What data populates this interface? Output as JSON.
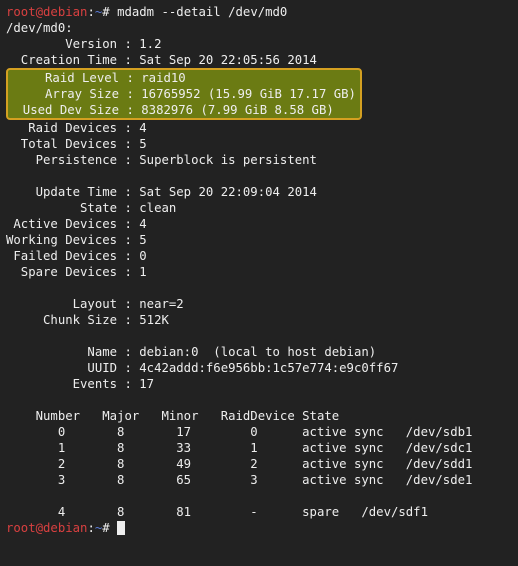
{
  "prompt1": {
    "user_host": "root@debian",
    "colon": ":",
    "path": "~",
    "hash": "# ",
    "cmd": "mdadm --detail /dev/md0"
  },
  "dev_line": "/dev/md0:",
  "kv": {
    "version": "        Version : 1.2",
    "creation": "  Creation Time : Sat Sep 20 22:05:56 2014",
    "raidlevel": "     Raid Level : raid10",
    "arraysize": "     Array Size : 16765952 (15.99 GiB 17.17 GB)",
    "useddev": "  Used Dev Size : 8382976 (7.99 GiB 8.58 GB)",
    "raiddevices": "   Raid Devices : 4",
    "totaldevices": "  Total Devices : 5",
    "persistence": "    Persistence : Superblock is persistent",
    "blank1": "",
    "updatetime": "    Update Time : Sat Sep 20 22:09:04 2014",
    "state": "          State : clean",
    "active": " Active Devices : 4",
    "working": "Working Devices : 5",
    "failed": " Failed Devices : 0",
    "spare": "  Spare Devices : 1",
    "blank2": "",
    "layout": "         Layout : near=2",
    "chunk": "     Chunk Size : 512K",
    "blank3": "",
    "name": "           Name : debian:0  (local to host debian)",
    "uuid": "           UUID : 4c42addd:f6e956bb:1c57e774:e9c0ff67",
    "events": "         Events : 17",
    "blank4": ""
  },
  "table": {
    "header": "    Number   Major   Minor   RaidDevice State",
    "rows": [
      "       0       8       17        0      active sync   /dev/sdb1",
      "       1       8       33        1      active sync   /dev/sdc1",
      "       2       8       49        2      active sync   /dev/sdd1",
      "       3       8       65        3      active sync   /dev/sde1",
      "",
      "       4       8       81        -      spare   /dev/sdf1"
    ]
  },
  "prompt2": {
    "user_host": "root@debian",
    "colon": ":",
    "path": "~",
    "hash": "# "
  }
}
